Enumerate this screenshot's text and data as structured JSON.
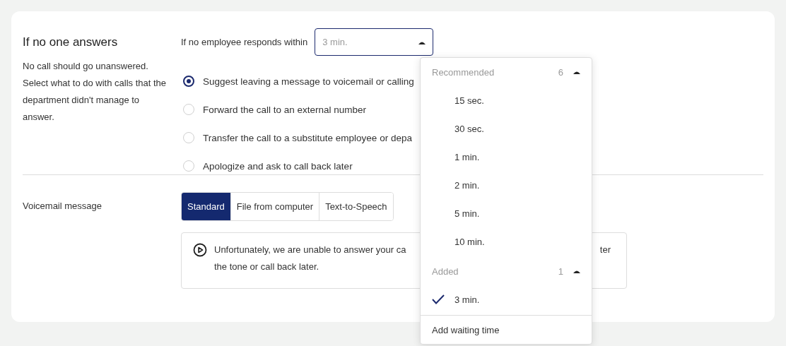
{
  "section": {
    "title": "If no one answers",
    "description": "No call should go unanswered. Select what to do with calls that the department didn't manage to answer."
  },
  "timeout": {
    "label": "If no employee responds within",
    "value": "3 min.",
    "expanded": true
  },
  "options": [
    {
      "label": "Suggest leaving a message to voicemail or calling",
      "selected": true
    },
    {
      "label": "Forward the call to an external number",
      "selected": false
    },
    {
      "label": "Transfer the call to a substitute employee or depa",
      "selected": false
    },
    {
      "label": "Apologize and ask to call back later",
      "selected": false
    }
  ],
  "voicemail": {
    "label": "Voicemail message",
    "tabs": [
      {
        "label": "Standard",
        "selected": true
      },
      {
        "label": "File from computer",
        "selected": false
      },
      {
        "label": "Text-to-Speech",
        "selected": false
      }
    ],
    "message_start": "Unfortunately, we are unable to answer your ca",
    "message_end_fragment": "ter",
    "message_line_2": "the tone or call back later."
  },
  "dropdown": {
    "groups": [
      {
        "title": "Recommended",
        "count": "6",
        "expanded": true,
        "items": [
          {
            "label": "15 sec.",
            "selected": false
          },
          {
            "label": "30 sec.",
            "selected": false
          },
          {
            "label": "1 min.",
            "selected": false
          },
          {
            "label": "2 min.",
            "selected": false
          },
          {
            "label": "5 min.",
            "selected": false
          },
          {
            "label": "10 min.",
            "selected": false
          }
        ]
      },
      {
        "title": "Added",
        "count": "1",
        "expanded": true,
        "items": [
          {
            "label": "3 min.",
            "selected": true
          }
        ]
      }
    ],
    "footer": "Add waiting time"
  }
}
